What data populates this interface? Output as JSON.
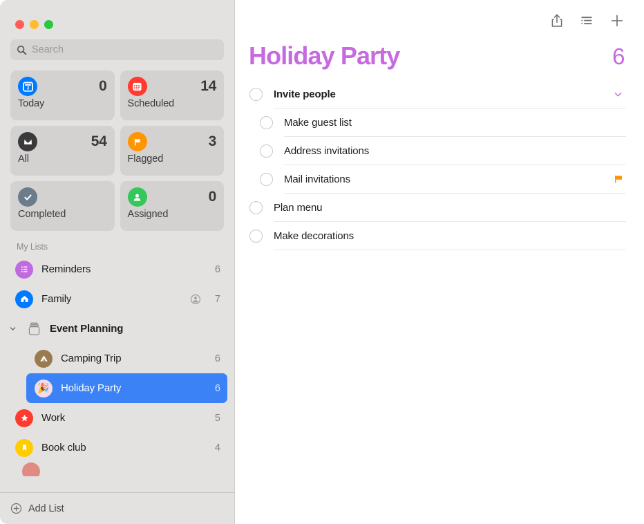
{
  "window": {
    "traffic_lights": [
      {
        "name": "close",
        "color": "#FF5F57"
      },
      {
        "name": "minimize",
        "color": "#FEBC2E"
      },
      {
        "name": "maximize",
        "color": "#28C840"
      }
    ]
  },
  "sidebar": {
    "search": {
      "placeholder": "Search",
      "value": "",
      "icon": "search-icon"
    },
    "smart_lists": [
      {
        "label": "Today",
        "count": "0",
        "icon": "calendar-today-icon",
        "icon_bg": "#007AFF",
        "day": "3"
      },
      {
        "label": "Scheduled",
        "count": "14",
        "icon": "calendar-icon",
        "icon_bg": "#FF3B30"
      },
      {
        "label": "All",
        "count": "54",
        "icon": "inbox-tray-icon",
        "icon_bg": "#3A3A3C"
      },
      {
        "label": "Flagged",
        "count": "3",
        "icon": "flag-icon",
        "icon_bg": "#FF9500"
      },
      {
        "label": "Completed",
        "count": "",
        "icon": "checkmark-icon",
        "icon_bg": "#6B7C8C"
      },
      {
        "label": "Assigned",
        "count": "0",
        "icon": "person-icon",
        "icon_bg": "#34C759"
      }
    ],
    "my_lists_header": "My Lists",
    "lists": [
      {
        "label": "Reminders",
        "count": "6",
        "icon": "bullet-list-icon",
        "icon_bg": "#C06AE0",
        "shared": false,
        "selected": false
      },
      {
        "label": "Family",
        "count": "7",
        "icon": "house-icon",
        "icon_bg": "#007AFF",
        "shared": true,
        "selected": false
      }
    ],
    "group": {
      "label": "Event Planning",
      "icon": "group-folder-icon",
      "expanded": true,
      "chevron": "chevron-down-icon",
      "lists": [
        {
          "label": "Camping Trip",
          "count": "6",
          "icon": "tent-icon",
          "icon_bg": "#9A7B4F",
          "selected": false
        },
        {
          "label": "Holiday Party",
          "count": "6",
          "icon": "party-popper-icon",
          "icon_bg": "#F2DCEC",
          "emoji": "🎉",
          "selected": true
        }
      ]
    },
    "lists_after": [
      {
        "label": "Work",
        "count": "5",
        "icon": "star-icon",
        "icon_bg": "#FF3B30",
        "selected": false
      },
      {
        "label": "Book club",
        "count": "4",
        "icon": "bookmark-icon",
        "icon_bg": "#FFCC00",
        "selected": false
      }
    ],
    "partial_list_color": "#E08B82",
    "add_list": {
      "label": "Add List",
      "icon": "plus-circle-icon"
    },
    "selection_color": "#3B82F6"
  },
  "main": {
    "toolbar": [
      {
        "name": "share-icon",
        "label": "Share"
      },
      {
        "name": "list-view-icon",
        "label": "View Options"
      },
      {
        "name": "plus-icon",
        "label": "New Reminder"
      }
    ],
    "title": "Holiday Party",
    "total": "6",
    "accent_color": "#C76AE0",
    "reminders": [
      {
        "text": "Invite people",
        "indent": false,
        "bold": true,
        "chevron": "chevron-down-icon",
        "flagged": false
      },
      {
        "text": "Make guest list",
        "indent": true,
        "bold": false,
        "flagged": false
      },
      {
        "text": "Address invitations",
        "indent": true,
        "bold": false,
        "flagged": false
      },
      {
        "text": "Mail invitations",
        "indent": true,
        "bold": false,
        "flagged": true,
        "flag_color": "#FF9500"
      },
      {
        "text": "Plan menu",
        "indent": false,
        "bold": false,
        "flagged": false
      },
      {
        "text": "Make decorations",
        "indent": false,
        "bold": false,
        "flagged": false
      }
    ]
  }
}
